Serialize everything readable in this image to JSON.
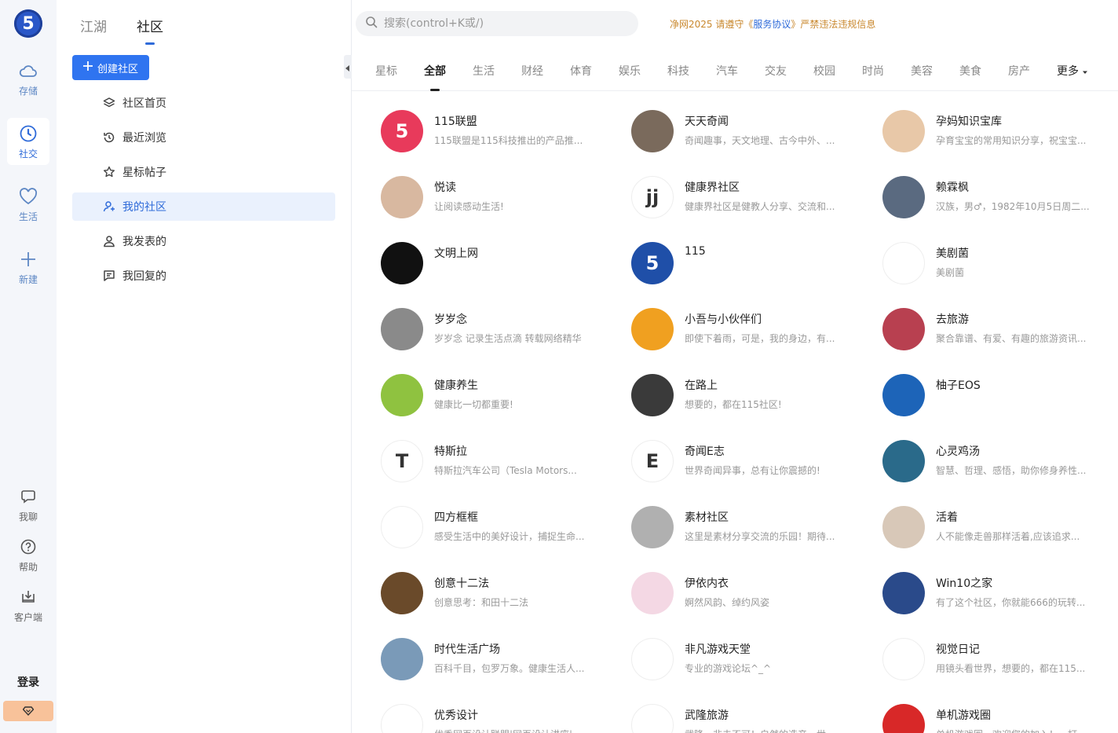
{
  "rail": {
    "logo": "5",
    "items": [
      {
        "label": "存储",
        "icon": "cloud-icon"
      },
      {
        "label": "社交",
        "icon": "clock-icon"
      },
      {
        "label": "生活",
        "icon": "heart-icon"
      },
      {
        "label": "新建",
        "icon": "plus-icon"
      }
    ],
    "bottom": [
      {
        "label": "我聊",
        "icon": "chat-icon"
      },
      {
        "label": "帮助",
        "icon": "help-icon"
      },
      {
        "label": "客户端",
        "icon": "download-icon"
      }
    ],
    "login": "登录"
  },
  "panel": {
    "tabs": [
      "江湖",
      "社区"
    ],
    "active_tab": "社区",
    "create_label": "创建社区",
    "nav": [
      {
        "label": "社区首页",
        "icon": "layers-icon"
      },
      {
        "label": "最近浏览",
        "icon": "history-icon"
      },
      {
        "label": "星标帖子",
        "icon": "star-icon"
      },
      {
        "label": "我的社区",
        "icon": "user-group-icon"
      },
      {
        "label": "我发表的",
        "icon": "user-icon"
      },
      {
        "label": "我回复的",
        "icon": "reply-icon"
      }
    ],
    "active_nav": "我的社区"
  },
  "search": {
    "placeholder": "搜索(control+K或/)"
  },
  "notice": {
    "prefix": "净网2025 请遵守《",
    "link": "服务协议",
    "suffix": "》严禁违法违规信息"
  },
  "categories": [
    "星标",
    "全部",
    "生活",
    "财经",
    "体育",
    "娱乐",
    "科技",
    "汽车",
    "交友",
    "校园",
    "时尚",
    "美容",
    "美食",
    "房产"
  ],
  "active_category": "全部",
  "more_label": "更多",
  "communities": [
    {
      "name": "115联盟",
      "desc": "115联盟是115科技推出的产品推...",
      "color": "#e83a5b",
      "glyph": "5"
    },
    {
      "name": "天天奇闻",
      "desc": "奇闻趣事，天文地理、古今中外、...",
      "color": "#7a6a5c",
      "glyph": ""
    },
    {
      "name": "孕妈知识宝库",
      "desc": "孕育宝宝的常用知识分享，祝宝宝...",
      "color": "#e8c8a8",
      "glyph": ""
    },
    {
      "name": "悦读",
      "desc": "让阅读感动生活!",
      "color": "#d8b8a0",
      "glyph": ""
    },
    {
      "name": "健康界社区",
      "desc": "健康界社区是健教人分享、交流和...",
      "color": "#ffffff",
      "glyph": "jj"
    },
    {
      "name": "赖霖枫",
      "desc": "汉族，男♂，1982年10月5日周二...",
      "color": "#5a6a80",
      "glyph": ""
    },
    {
      "name": "文明上网",
      "desc": "",
      "color": "#111111",
      "glyph": ""
    },
    {
      "name": "115",
      "desc": "",
      "color": "#1f4fa8",
      "glyph": "5"
    },
    {
      "name": "美剧菌",
      "desc": "美剧菌",
      "color": "#ffffff",
      "glyph": ""
    },
    {
      "name": "岁岁念",
      "desc": "岁岁念 记录生活点滴 转载网络精华",
      "color": "#8a8a8a",
      "glyph": ""
    },
    {
      "name": "小吾与小伙伴们",
      "desc": "即使下着雨，可是，我的身边，有...",
      "color": "#f0a020",
      "glyph": ""
    },
    {
      "name": "去旅游",
      "desc": "聚合靠谱、有爱、有趣的旅游资讯...",
      "color": "#b84050",
      "glyph": ""
    },
    {
      "name": "健康养生",
      "desc": "健康比一切都重要!",
      "color": "#8fc240",
      "glyph": ""
    },
    {
      "name": "在路上",
      "desc": "想要的，都在115社区!",
      "color": "#3a3a3a",
      "glyph": ""
    },
    {
      "name": "柚子EOS",
      "desc": "",
      "color": "#1d64b8",
      "glyph": ""
    },
    {
      "name": "特斯拉",
      "desc": "特斯拉汽车公司（Tesla Motors...",
      "color": "#ffffff",
      "glyph": "T"
    },
    {
      "name": "奇闻E志",
      "desc": "世界奇闻异事，总有让你震撼的!",
      "color": "#ffffff",
      "glyph": "E"
    },
    {
      "name": "心灵鸡汤",
      "desc": "智慧、哲理、感悟，助你修身养性...",
      "color": "#2a6a8a",
      "glyph": ""
    },
    {
      "name": "四方框框",
      "desc": "感受生活中的美好设计，捕捉生命...",
      "color": "#ffffff",
      "glyph": ""
    },
    {
      "name": "素材社区",
      "desc": "这里是素材分享交流的乐园！期待...",
      "color": "#b0b0b0",
      "glyph": ""
    },
    {
      "name": "活着",
      "desc": "人不能像走兽那样活着,应该追求...",
      "color": "#d8c8b8",
      "glyph": ""
    },
    {
      "name": "创意十二法",
      "desc": "创意思考：和田十二法",
      "color": "#6a4a2a",
      "glyph": ""
    },
    {
      "name": "伊依内衣",
      "desc": "婀然风韵、绰约风姿",
      "color": "#f4d8e4",
      "glyph": ""
    },
    {
      "name": "Win10之家",
      "desc": "有了这个社区，你就能666的玩转...",
      "color": "#2a4a8a",
      "glyph": ""
    },
    {
      "name": "时代生活广场",
      "desc": "百科千目，包罗万象。健康生活人...",
      "color": "#7a9ab8",
      "glyph": ""
    },
    {
      "name": "非凡游戏天堂",
      "desc": "专业的游戏论坛^_^",
      "color": "#ffffff",
      "glyph": ""
    },
    {
      "name": "视觉日记",
      "desc": "用镜头看世界，想要的，都在115...",
      "color": "#ffffff",
      "glyph": ""
    },
    {
      "name": "优秀设计",
      "desc": "优秀网页设计联盟|网页设计讲座|...",
      "color": "#ffffff",
      "glyph": ""
    },
    {
      "name": "武隆旅游",
      "desc": "武隆，非去不可！自然的造产，世...",
      "color": "#ffffff",
      "glyph": ""
    },
    {
      "name": "单机游戏圈",
      "desc": "单机游戏圈，欢迎您的加入！ - 打...",
      "color": "#d82828",
      "glyph": ""
    }
  ],
  "colors": {
    "accent": "#2f6bd9",
    "button": "#2f74f0",
    "notice": "#c9882e"
  }
}
